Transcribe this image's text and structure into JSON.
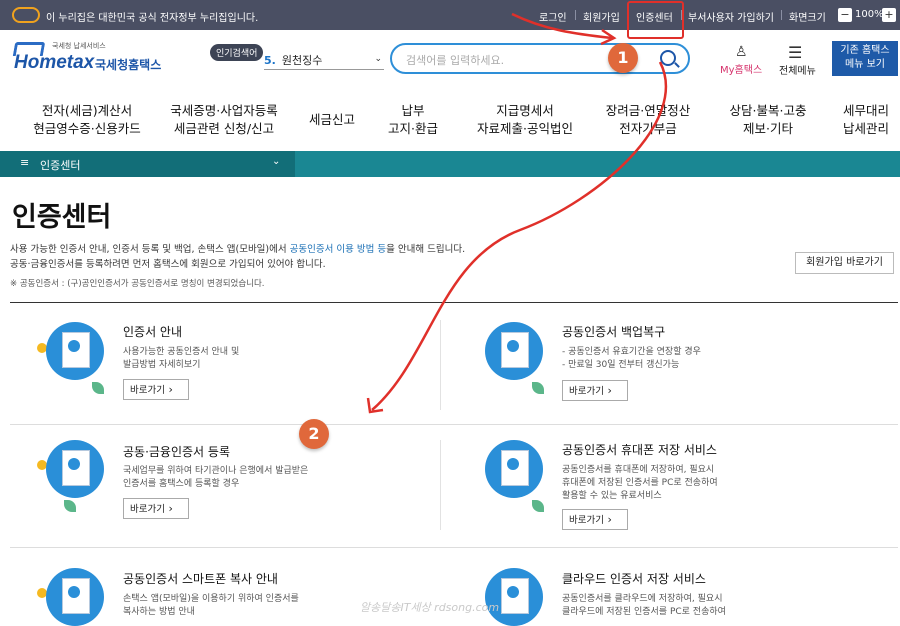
{
  "topbar": {
    "gov_notice": "이 누리집은 대한민국 공식 전자정부 누리집입니다.",
    "links": [
      "로그인",
      "회원가입",
      "인증센터",
      "부서사용자 가입하기",
      "화면크기"
    ],
    "zoom": "100%",
    "zoom_minus": "−",
    "zoom_plus": "+"
  },
  "logo": {
    "sub": "국세청 납세서비스",
    "main": "Hometax",
    "kr": "국세청홈택스"
  },
  "popular": {
    "badge": "인기검색어",
    "rank": "5.",
    "term": "원천징수",
    "caret": "⌄"
  },
  "search": {
    "placeholder": "검색어를 입력하세요."
  },
  "header": {
    "my_label": "My홈택스",
    "menu_label": "전체메뉴",
    "old_menu": "기존 홈택스\n메뉴 보기",
    "my_icon": "♙",
    "menu_icon": "☰"
  },
  "gnb": [
    "전자(세금)계산서\n현금영수증·신용카드",
    "국세증명·사업자등록\n세금관련 신청/신고",
    "세금신고",
    "납부\n고지·환급",
    "지급명세서\n자료제출·공익법인",
    "장려금·연말정산\n전자기부금",
    "상담·불복·고충\n제보·기타",
    "세무대리\n납세관리"
  ],
  "breadcrumb": {
    "icon": "≡",
    "label": "인증센터",
    "caret": "⌄"
  },
  "page": {
    "title": "인증센터",
    "intro1_a": "사용 가능한 인증서 안내, 인증서 등록 및 백업, 손택스 앱(모바일)에서 ",
    "intro1_b": "공동인증서 이용 방법 등",
    "intro1_c": "을 안내해 드립니다.",
    "intro2": "공동·금융인증서를 등록하려면 먼저 홈택스에 회원으로 가입되어 있어야 합니다.",
    "note": "※ 공동인증서 : (구)공인인증서가 공동인증서로 명칭이 변경되었습니다.",
    "join_button": "회원가입 바로가기"
  },
  "cards": [
    {
      "title": "인증서 안내",
      "desc": "사용가능한 공동인증서 안내 및\n발급방법 자세히보기",
      "button": "바로가기"
    },
    {
      "title": "공동인증서 백업복구",
      "desc": "- 공동인증서 유효기간을 연장할 경우\n- 만료일 30일 전부터 갱신가능",
      "button": "바로가기"
    },
    {
      "title": "공동·금융인증서 등록",
      "desc": "국세업무를 위하여 타기관이나 은행에서 발급받은\n인증서를 홈택스에 등록할 경우",
      "button": "바로가기"
    },
    {
      "title": "공동인증서 휴대폰 저장 서비스",
      "desc": "공동인증서를 휴대폰에 저장하여, 필요시\n휴대폰에 저장된 인증서를 PC로 전송하여\n활용할 수 있는 유료서비스",
      "button": "바로가기"
    },
    {
      "title": "공동인증서 스마트폰 복사 안내",
      "desc": "손택스 앱(모바일)을 이용하기 위하여 인증서를\n복사하는 방법 안내",
      "button": ""
    },
    {
      "title": "클라우드 인증서 저장 서비스",
      "desc": "공동인증서를 클라우드에 저장하여, 필요시\n클라우드에 저장된 인증서를 PC로 전송하여",
      "button": ""
    }
  ],
  "annotations": {
    "marker1": "1",
    "marker2": "2",
    "accent": "#e0302a"
  },
  "watermark": "알송달송IT세상 rdsong.com"
}
